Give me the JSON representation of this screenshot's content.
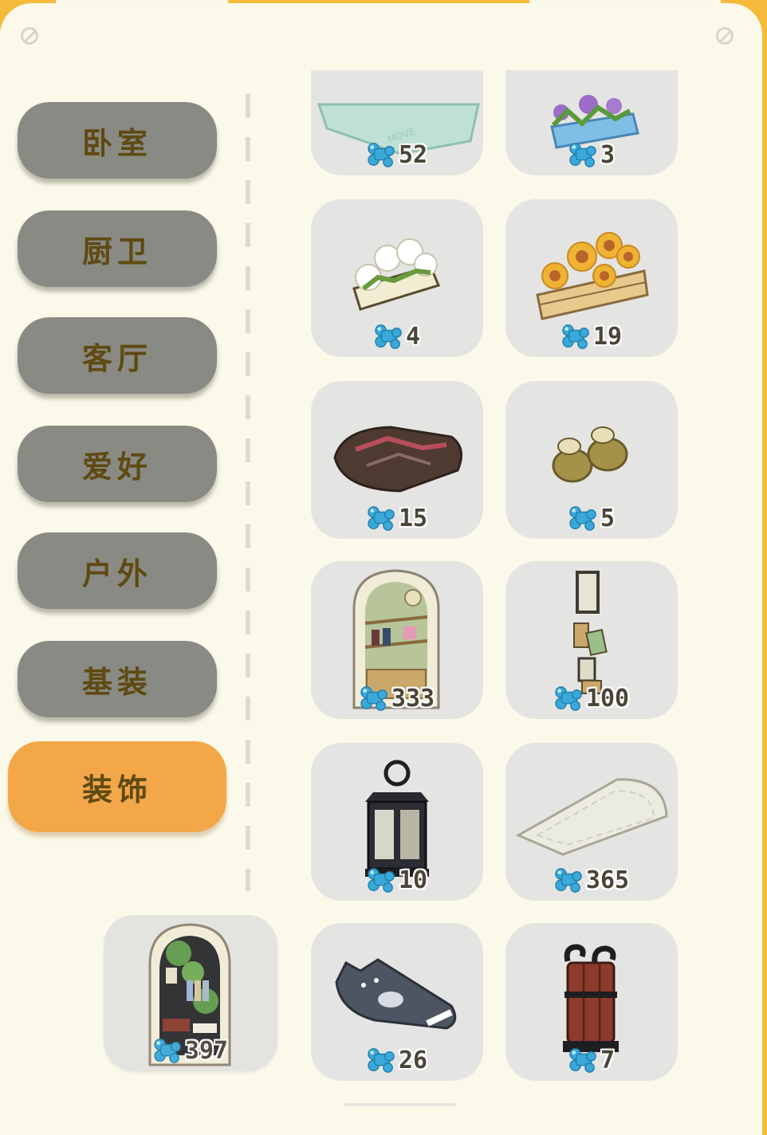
{
  "categories": [
    {
      "label": "卧室",
      "active": false
    },
    {
      "label": "厨卫",
      "active": false
    },
    {
      "label": "客厅",
      "active": false
    },
    {
      "label": "爱好",
      "active": false
    },
    {
      "label": "户外",
      "active": false
    },
    {
      "label": "基装",
      "active": false
    },
    {
      "label": "装饰",
      "active": true
    }
  ],
  "items": [
    {
      "name": "mint-rug",
      "price": "52"
    },
    {
      "name": "flower-planter-blue",
      "price": "3"
    },
    {
      "name": "white-flower-planter",
      "price": "4"
    },
    {
      "name": "sunflower-crate",
      "price": "19"
    },
    {
      "name": "brown-rug",
      "price": "15"
    },
    {
      "name": "slippers",
      "price": "5"
    },
    {
      "name": "arched-bookshelf",
      "price": "333"
    },
    {
      "name": "wall-frames",
      "price": "100"
    },
    {
      "name": "lantern",
      "price": "10"
    },
    {
      "name": "white-half-rug",
      "price": "365"
    },
    {
      "name": "cat-rug",
      "price": "26"
    },
    {
      "name": "umbrella-stand",
      "price": "7"
    }
  ],
  "dragged_item": {
    "name": "arched-plant-shelf",
    "price": "397"
  },
  "colors": {
    "frame": "#f5ba3c",
    "panel": "#fbfaea",
    "button": "#8a8a84",
    "active_button": "#f4a748",
    "label_text": "#5e4a12",
    "card": "#e4e4e2",
    "currency": "#3aa8d8"
  },
  "icons": {
    "currency": "blue-bone-icon",
    "corner": "disabled-icon"
  }
}
